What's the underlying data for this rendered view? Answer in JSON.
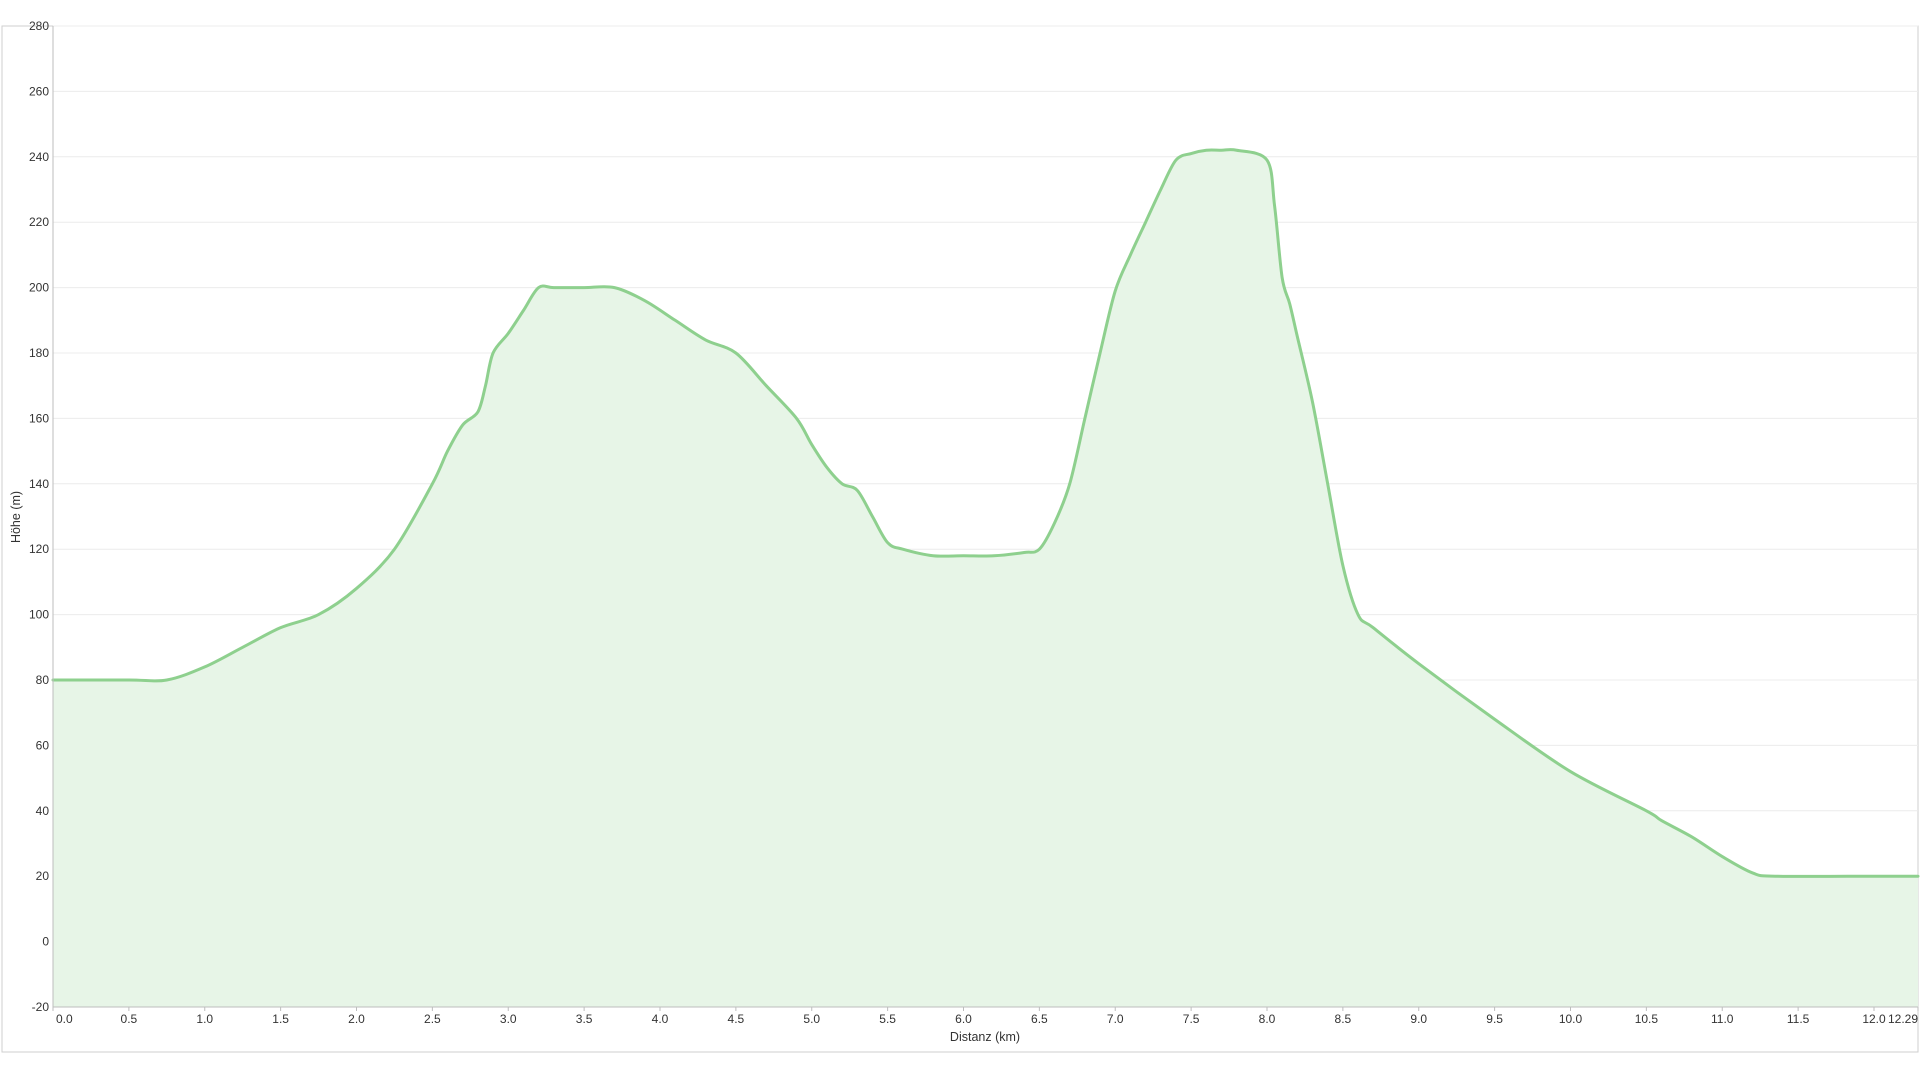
{
  "chart_data": {
    "type": "area",
    "title": "",
    "xlabel": "Distanz (km)",
    "ylabel": "Höhe (m)",
    "xlim": [
      0,
      12.29
    ],
    "ylim": [
      -20,
      280
    ],
    "x_ticks": [
      "0.0",
      "0.5",
      "1.0",
      "1.5",
      "2.0",
      "2.5",
      "3.0",
      "3.5",
      "4.0",
      "4.5",
      "5.0",
      "5.5",
      "6.0",
      "6.5",
      "7.0",
      "7.5",
      "8.0",
      "8.5",
      "9.0",
      "9.5",
      "10.0",
      "10.5",
      "11.0",
      "11.5",
      "12.0",
      "12.29"
    ],
    "y_ticks": [
      "280",
      "260",
      "240",
      "220",
      "200",
      "180",
      "160",
      "140",
      "120",
      "100",
      "80",
      "60",
      "40",
      "20",
      "0",
      "-20"
    ],
    "grid": "horizontal",
    "colors": {
      "line": "#8ed08e",
      "fill": "#e7f5e7",
      "grid": "#ececec",
      "axis": "#bdbdbd"
    },
    "series": [
      {
        "x": [
          0,
          0.5,
          0.75,
          1.0,
          1.25,
          1.5,
          1.75,
          2.0,
          2.25,
          2.5,
          2.6,
          2.7,
          2.8,
          2.85,
          2.9,
          3.0,
          3.1,
          3.2,
          3.3,
          3.5,
          3.7,
          3.9,
          4.1,
          4.3,
          4.5,
          4.7,
          4.9,
          5.0,
          5.1,
          5.2,
          5.3,
          5.4,
          5.5,
          5.6,
          5.8,
          6.0,
          6.2,
          6.4,
          6.5,
          6.6,
          6.7,
          6.8,
          6.9,
          7.0,
          7.1,
          7.2,
          7.3,
          7.4,
          7.5,
          7.6,
          7.7,
          7.8,
          8.0,
          8.05,
          8.1,
          8.15,
          8.2,
          8.3,
          8.4,
          8.5,
          8.6,
          8.7,
          9.0,
          9.5,
          10.0,
          10.5,
          10.6,
          10.8,
          11.0,
          11.2,
          11.35,
          12.0,
          12.29
        ],
        "y": [
          80,
          80,
          80,
          84,
          90,
          96,
          100,
          108,
          120,
          140,
          150,
          158,
          162,
          170,
          180,
          186,
          193,
          200,
          200,
          200,
          200,
          196,
          190,
          184,
          180,
          170,
          160,
          152,
          145,
          140,
          138,
          130,
          122,
          120,
          118,
          118,
          118,
          119,
          120,
          128,
          140,
          160,
          180,
          199,
          210,
          220,
          230,
          239,
          241,
          242,
          242,
          242,
          239,
          225,
          203,
          195,
          185,
          165,
          140,
          115,
          100,
          96,
          85,
          68,
          52,
          40,
          37,
          32,
          26,
          21,
          20,
          20,
          20
        ]
      }
    ]
  }
}
